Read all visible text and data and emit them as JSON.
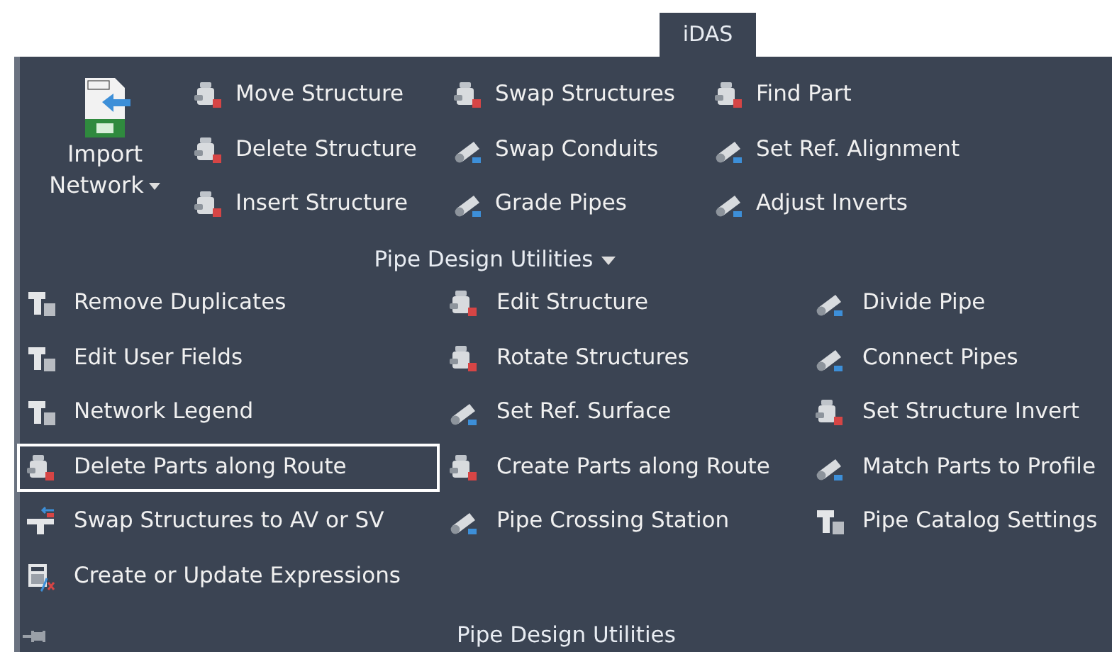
{
  "tab": {
    "label": "iDAS",
    "selected": true
  },
  "ribbon": {
    "large_button": {
      "label_lines": [
        "Import",
        "Network"
      ]
    },
    "buttons": [
      {
        "label": "Move Structure",
        "kind": "structure"
      },
      {
        "label": "Swap Structures",
        "kind": "structure"
      },
      {
        "label": "Find Part",
        "kind": "structure"
      },
      {
        "label": "Delete Structure",
        "kind": "structure"
      },
      {
        "label": "Swap Conduits",
        "kind": "pipe"
      },
      {
        "label": "Set Ref. Alignment",
        "kind": "pipe"
      },
      {
        "label": "Insert Structure",
        "kind": "structure"
      },
      {
        "label": "Grade Pipes",
        "kind": "pipe"
      },
      {
        "label": "Adjust Inverts",
        "kind": "pipe"
      }
    ],
    "panel_title": "Pipe Design Utilities"
  },
  "dropdown": {
    "items": [
      {
        "label": "Remove Duplicates",
        "kind": "fitting",
        "selected": false
      },
      {
        "label": "Edit Structure",
        "kind": "structure",
        "selected": false
      },
      {
        "label": "Divide Pipe",
        "kind": "pipe",
        "selected": false
      },
      {
        "label": "Edit User Fields",
        "kind": "fitting",
        "selected": false
      },
      {
        "label": "Rotate Structures",
        "kind": "structure",
        "selected": false
      },
      {
        "label": "Connect Pipes",
        "kind": "pipe",
        "selected": false
      },
      {
        "label": "Network Legend",
        "kind": "fitting",
        "selected": false
      },
      {
        "label": "Set Ref. Surface",
        "kind": "pipe",
        "selected": false
      },
      {
        "label": "Set Structure Invert",
        "kind": "structure",
        "selected": false
      },
      {
        "label": "Delete Parts along Route",
        "kind": "structure",
        "selected": true
      },
      {
        "label": "Create Parts along Route",
        "kind": "structure",
        "selected": false
      },
      {
        "label": "Match Parts to Profile",
        "kind": "pipe",
        "selected": false
      },
      {
        "label": "Swap Structures to AV or SV",
        "kind": "tee",
        "selected": false
      },
      {
        "label": "Pipe Crossing Station",
        "kind": "pipe",
        "selected": false
      },
      {
        "label": "Pipe Catalog Settings",
        "kind": "fitting",
        "selected": false
      },
      {
        "label": "Create or Update Expressions",
        "kind": "calculator",
        "selected": false
      }
    ],
    "panel_title": "Pipe Design Utilities"
  }
}
